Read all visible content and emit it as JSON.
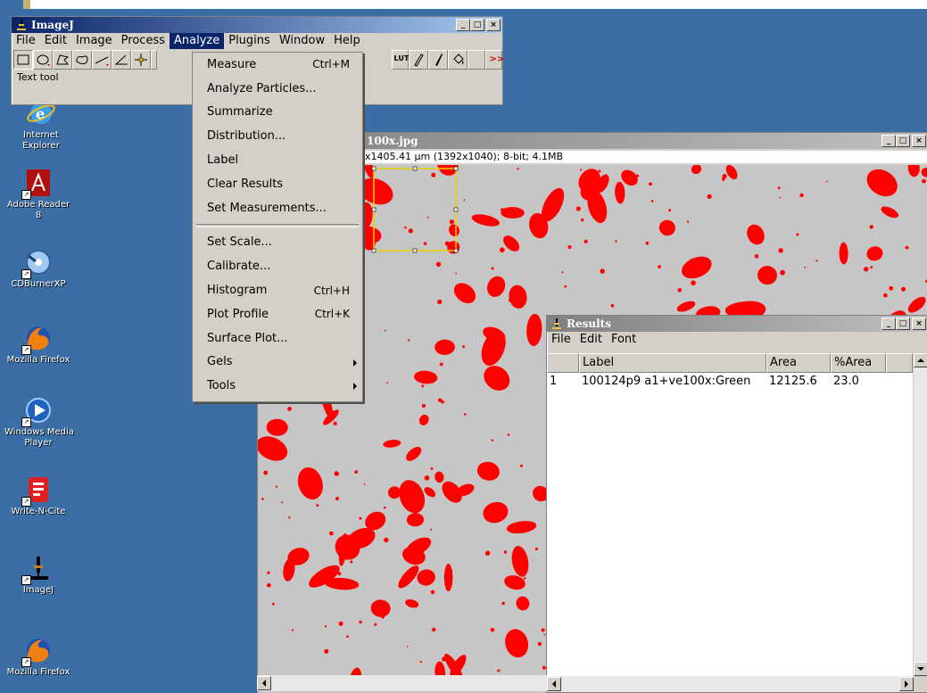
{
  "desktop": {
    "icons": [
      {
        "label": "Internet\nExplorer",
        "icon": "internet-explorer-icon"
      },
      {
        "label": "Adobe Reader\n8",
        "icon": "adobe-reader-icon"
      },
      {
        "label": "CDBurnerXP",
        "icon": "cdburnerxp-icon"
      },
      {
        "label": "Mozilla Firefox",
        "icon": "firefox-icon"
      },
      {
        "label": "Windows Media\nPlayer",
        "icon": "windows-media-player-icon"
      },
      {
        "label": "Write-N-Cite",
        "icon": "write-n-cite-icon"
      },
      {
        "label": "ImageJ",
        "icon": "imagej-icon"
      },
      {
        "label": "Mozilla Firefox",
        "icon": "firefox-icon"
      }
    ]
  },
  "imagej": {
    "title": "ImageJ",
    "menu": [
      "File",
      "Edit",
      "Image",
      "Process",
      "Analyze",
      "Plugins",
      "Window",
      "Help"
    ],
    "selected_menu": "Analyze",
    "toolbar_lut": "LUT",
    "toolbar_more": ">>",
    "status": "Text tool"
  },
  "analyze_menu": {
    "items": [
      {
        "label": "Measure",
        "shortcut": "Ctrl+M"
      },
      {
        "label": "Analyze Particles..."
      },
      {
        "label": "Summarize"
      },
      {
        "label": "Distribution..."
      },
      {
        "label": "Label"
      },
      {
        "label": "Clear Results"
      },
      {
        "label": "Set Measurements..."
      },
      {
        "label": "Set Scale..."
      },
      {
        "label": "Calibrate..."
      },
      {
        "label": "Histogram",
        "shortcut": "Ctrl+H"
      },
      {
        "label": "Plot Profile",
        "shortcut": "Ctrl+K"
      },
      {
        "label": "Surface Plot..."
      },
      {
        "label": "Gels"
      },
      {
        "label": "Tools"
      }
    ]
  },
  "image_window": {
    "title_visible": "100x.jpg",
    "info": "x1405.41 µm (1392x1040); 8-bit; 4.1MB"
  },
  "results_window": {
    "title": "Results",
    "menu": [
      "File",
      "Edit",
      "Font"
    ],
    "columns": [
      "",
      "Label",
      "Area",
      "%Area"
    ],
    "rows": [
      {
        "index": "1",
        "label": "100124p9 a1+ve100x:Green",
        "area": "12125.6",
        "pct_area": "23.0"
      }
    ]
  },
  "colors": {
    "desktop": "#3a6ea5",
    "title_active": "#0a246a",
    "highlight": "#ff0000",
    "roi": "#e8d000"
  }
}
